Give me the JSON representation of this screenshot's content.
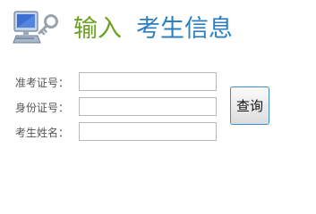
{
  "header": {
    "title_part1": "输入",
    "title_part2": "考生信息",
    "icon": "computer-key-icon"
  },
  "form": {
    "fields": [
      {
        "label": "准考证号：",
        "value": "",
        "placeholder": ""
      },
      {
        "label": "身份证号：",
        "value": "",
        "placeholder": ""
      },
      {
        "label": "考生姓名：",
        "value": "",
        "placeholder": ""
      }
    ],
    "submit_label": "查询"
  },
  "colors": {
    "title_green": "#6aa121",
    "title_blue": "#2b7fc1",
    "button_border": "#3e8cc9"
  }
}
